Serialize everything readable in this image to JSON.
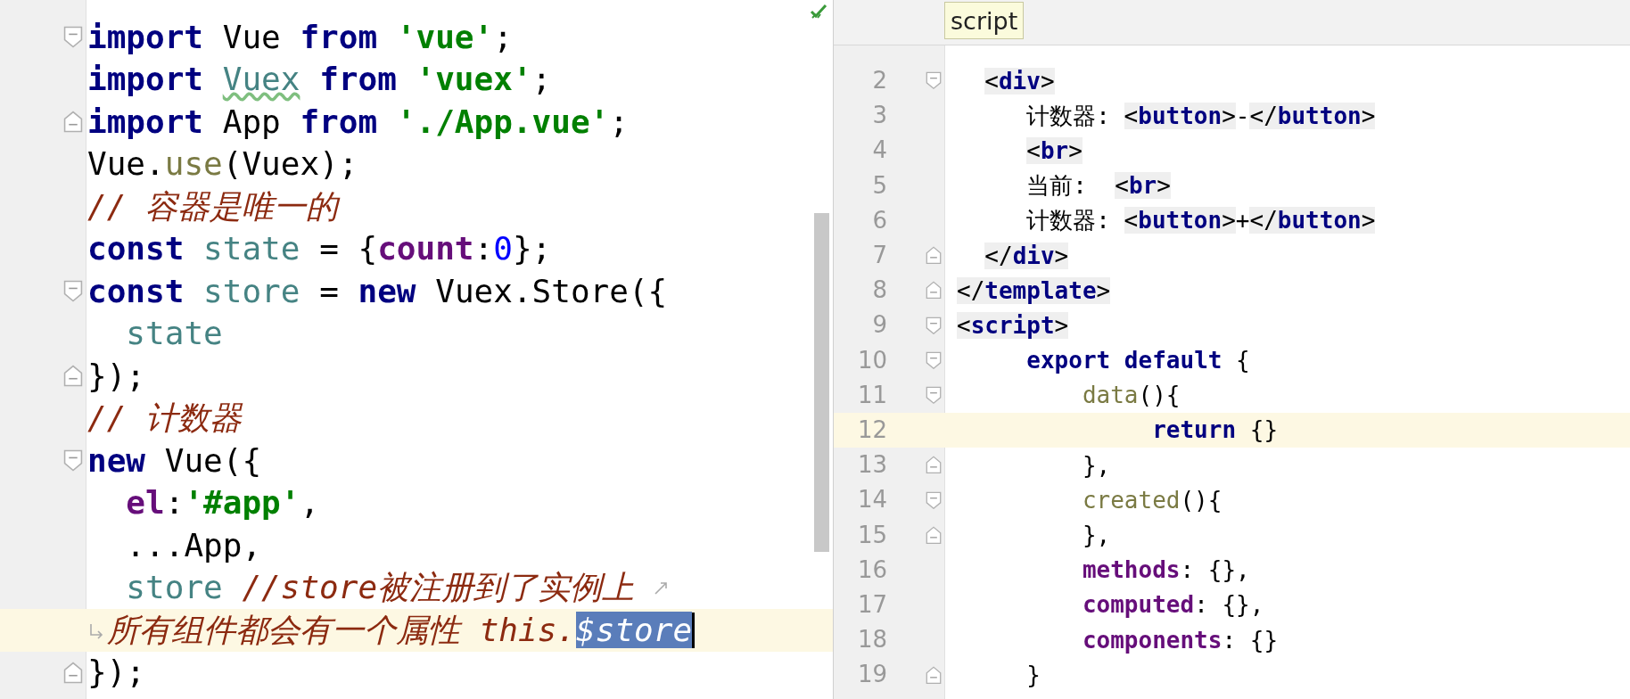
{
  "left_editor": {
    "focused": true,
    "lines": [
      {
        "fold_open": true,
        "fold_close": false,
        "wrap_end": false,
        "wrap_start": false,
        "current": false,
        "tokens": [
          {
            "kind": "keyword",
            "text": "import"
          },
          {
            "kind": "plain",
            "text": " Vue "
          },
          {
            "kind": "keyword",
            "text": "from"
          },
          {
            "kind": "string",
            "text": " 'vue'"
          },
          {
            "kind": "plain",
            "text": ";"
          }
        ]
      },
      {
        "fold_open": false,
        "fold_close": false,
        "wrap_end": false,
        "wrap_start": false,
        "current": false,
        "tokens": [
          {
            "kind": "keyword",
            "text": "import"
          },
          {
            "kind": "field-warning",
            "text": " Vuex"
          },
          {
            "kind": "keyword",
            "text": " from"
          },
          {
            "kind": "string",
            "text": " 'vuex'"
          },
          {
            "kind": "plain",
            "text": ";"
          }
        ]
      },
      {
        "fold_open": false,
        "fold_close": true,
        "wrap_end": false,
        "wrap_start": false,
        "current": false,
        "tokens": [
          {
            "kind": "keyword",
            "text": "import"
          },
          {
            "kind": "plain",
            "text": " App "
          },
          {
            "kind": "keyword",
            "text": "from"
          },
          {
            "kind": "string",
            "text": " './App.vue'"
          },
          {
            "kind": "plain",
            "text": ";"
          }
        ]
      },
      {
        "fold_open": false,
        "fold_close": false,
        "wrap_end": false,
        "wrap_start": false,
        "current": false,
        "tokens": [
          {
            "kind": "plain",
            "text": "Vue."
          },
          {
            "kind": "function",
            "text": "use"
          },
          {
            "kind": "plain",
            "text": "(Vuex);"
          }
        ]
      },
      {
        "fold_open": false,
        "fold_close": false,
        "wrap_end": false,
        "wrap_start": false,
        "current": false,
        "tokens": [
          {
            "kind": "comment",
            "text": "// 容器是唯一的"
          }
        ]
      },
      {
        "fold_open": false,
        "fold_close": false,
        "wrap_end": false,
        "wrap_start": false,
        "current": false,
        "tokens": [
          {
            "kind": "keyword",
            "text": "const"
          },
          {
            "kind": "field",
            "text": " state"
          },
          {
            "kind": "plain",
            "text": " = {"
          },
          {
            "kind": "property",
            "text": "count"
          },
          {
            "kind": "plain",
            "text": ":"
          },
          {
            "kind": "number",
            "text": "0"
          },
          {
            "kind": "plain",
            "text": "};"
          }
        ]
      },
      {
        "fold_open": true,
        "fold_close": false,
        "wrap_end": false,
        "wrap_start": false,
        "current": false,
        "tokens": [
          {
            "kind": "keyword",
            "text": "const"
          },
          {
            "kind": "field",
            "text": " store"
          },
          {
            "kind": "plain",
            "text": " = "
          },
          {
            "kind": "keyword",
            "text": "new"
          },
          {
            "kind": "plain",
            "text": " Vuex.Store({"
          }
        ]
      },
      {
        "fold_open": false,
        "fold_close": false,
        "wrap_end": false,
        "wrap_start": false,
        "current": false,
        "tokens": [
          {
            "kind": "field",
            "text": "  state"
          }
        ]
      },
      {
        "fold_open": false,
        "fold_close": true,
        "wrap_end": false,
        "wrap_start": false,
        "current": false,
        "tokens": [
          {
            "kind": "plain",
            "text": "});"
          }
        ]
      },
      {
        "fold_open": false,
        "fold_close": false,
        "wrap_end": false,
        "wrap_start": false,
        "current": false,
        "tokens": [
          {
            "kind": "comment",
            "text": "// 计数器"
          }
        ]
      },
      {
        "fold_open": true,
        "fold_close": false,
        "wrap_end": false,
        "wrap_start": false,
        "current": false,
        "tokens": [
          {
            "kind": "keyword",
            "text": "new"
          },
          {
            "kind": "plain",
            "text": " Vue({"
          }
        ]
      },
      {
        "fold_open": false,
        "fold_close": false,
        "wrap_end": false,
        "wrap_start": false,
        "current": false,
        "tokens": [
          {
            "kind": "property",
            "text": "  el"
          },
          {
            "kind": "plain",
            "text": ":"
          },
          {
            "kind": "string",
            "text": "'#app'"
          },
          {
            "kind": "plain",
            "text": ","
          }
        ]
      },
      {
        "fold_open": false,
        "fold_close": false,
        "wrap_end": false,
        "wrap_start": false,
        "current": false,
        "tokens": [
          {
            "kind": "plain",
            "text": "  ...App,"
          }
        ]
      },
      {
        "fold_open": false,
        "fold_close": false,
        "wrap_end": true,
        "wrap_start": false,
        "current": false,
        "tokens": [
          {
            "kind": "field",
            "text": "  store"
          },
          {
            "kind": "comment",
            "text": " //store被注册到了实例上"
          }
        ]
      },
      {
        "fold_open": false,
        "fold_close": false,
        "wrap_end": false,
        "wrap_start": true,
        "current": true,
        "tokens": [
          {
            "kind": "comment",
            "text": "所有组件都会有一个属性 this."
          },
          {
            "kind": "selection",
            "text": "$store"
          }
        ]
      },
      {
        "fold_open": false,
        "fold_close": true,
        "wrap_end": false,
        "wrap_start": false,
        "current": false,
        "tokens": [
          {
            "kind": "plain",
            "text": "});"
          }
        ]
      }
    ]
  },
  "right_editor": {
    "focused": false,
    "tooltip": "script",
    "lines": [
      {
        "number": "2",
        "fold_open": true,
        "fold_close": false,
        "current": false,
        "tokens": [
          {
            "kind": "tag-punct",
            "text": "  <"
          },
          {
            "kind": "tag",
            "text": "div"
          },
          {
            "kind": "tag-punct",
            "text": ">"
          }
        ]
      },
      {
        "number": "3",
        "fold_open": false,
        "fold_close": false,
        "current": false,
        "tokens": [
          {
            "kind": "plain",
            "text": "     计数器: "
          },
          {
            "kind": "tag-punct",
            "text": "<"
          },
          {
            "kind": "tag",
            "text": "button"
          },
          {
            "kind": "tag-punct",
            "text": ">"
          },
          {
            "kind": "plain",
            "text": "-"
          },
          {
            "kind": "tag-punct",
            "text": "</"
          },
          {
            "kind": "tag",
            "text": "button"
          },
          {
            "kind": "tag-punct",
            "text": ">"
          }
        ]
      },
      {
        "number": "4",
        "fold_open": false,
        "fold_close": false,
        "current": false,
        "tokens": [
          {
            "kind": "tag-punct",
            "text": "     <"
          },
          {
            "kind": "tag",
            "text": "br"
          },
          {
            "kind": "tag-punct",
            "text": ">"
          }
        ]
      },
      {
        "number": "5",
        "fold_open": false,
        "fold_close": false,
        "current": false,
        "tokens": [
          {
            "kind": "plain",
            "text": "     当前:  "
          },
          {
            "kind": "tag-punct",
            "text": "<"
          },
          {
            "kind": "tag",
            "text": "br"
          },
          {
            "kind": "tag-punct",
            "text": ">"
          }
        ]
      },
      {
        "number": "6",
        "fold_open": false,
        "fold_close": false,
        "current": false,
        "tokens": [
          {
            "kind": "plain",
            "text": "     计数器: "
          },
          {
            "kind": "tag-punct",
            "text": "<"
          },
          {
            "kind": "tag",
            "text": "button"
          },
          {
            "kind": "tag-punct",
            "text": ">"
          },
          {
            "kind": "plain",
            "text": "+"
          },
          {
            "kind": "tag-punct",
            "text": "</"
          },
          {
            "kind": "tag",
            "text": "button"
          },
          {
            "kind": "tag-punct",
            "text": ">"
          }
        ]
      },
      {
        "number": "7",
        "fold_open": false,
        "fold_close": true,
        "current": false,
        "tokens": [
          {
            "kind": "tag-punct",
            "text": "  </"
          },
          {
            "kind": "tag",
            "text": "div"
          },
          {
            "kind": "tag-punct",
            "text": ">"
          }
        ]
      },
      {
        "number": "8",
        "fold_open": false,
        "fold_close": true,
        "current": false,
        "tokens": [
          {
            "kind": "tag-punct",
            "text": "</"
          },
          {
            "kind": "tag",
            "text": "template"
          },
          {
            "kind": "tag-punct",
            "text": ">"
          }
        ]
      },
      {
        "number": "9",
        "fold_open": true,
        "fold_close": false,
        "current": false,
        "tokens": [
          {
            "kind": "tag-punct",
            "text": "<"
          },
          {
            "kind": "tag",
            "text": "script"
          },
          {
            "kind": "tag-punct",
            "text": ">"
          }
        ]
      },
      {
        "number": "10",
        "fold_open": true,
        "fold_close": false,
        "current": false,
        "tokens": [
          {
            "kind": "keyword",
            "text": "     export"
          },
          {
            "kind": "keyword",
            "text": " default"
          },
          {
            "kind": "plain",
            "text": " {"
          }
        ]
      },
      {
        "number": "11",
        "fold_open": true,
        "fold_close": false,
        "current": false,
        "tokens": [
          {
            "kind": "function",
            "text": "         data"
          },
          {
            "kind": "plain",
            "text": "(){"
          }
        ]
      },
      {
        "number": "12",
        "fold_open": false,
        "fold_close": false,
        "current": true,
        "tokens": [
          {
            "kind": "keyword",
            "text": "              return"
          },
          {
            "kind": "plain",
            "text": " {}"
          }
        ]
      },
      {
        "number": "13",
        "fold_open": false,
        "fold_close": true,
        "current": false,
        "tokens": [
          {
            "kind": "plain",
            "text": "         },"
          }
        ]
      },
      {
        "number": "14",
        "fold_open": true,
        "fold_close": false,
        "current": false,
        "tokens": [
          {
            "kind": "function",
            "text": "         created"
          },
          {
            "kind": "plain",
            "text": "(){"
          }
        ]
      },
      {
        "number": "15",
        "fold_open": false,
        "fold_close": true,
        "current": false,
        "tokens": [
          {
            "kind": "plain",
            "text": "         },"
          }
        ]
      },
      {
        "number": "16",
        "fold_open": false,
        "fold_close": false,
        "current": false,
        "tokens": [
          {
            "kind": "property",
            "text": "         methods"
          },
          {
            "kind": "plain",
            "text": ": {},"
          }
        ]
      },
      {
        "number": "17",
        "fold_open": false,
        "fold_close": false,
        "current": false,
        "tokens": [
          {
            "kind": "property",
            "text": "         computed"
          },
          {
            "kind": "plain",
            "text": ": {},"
          }
        ]
      },
      {
        "number": "18",
        "fold_open": false,
        "fold_close": false,
        "current": false,
        "tokens": [
          {
            "kind": "property",
            "text": "         components"
          },
          {
            "kind": "plain",
            "text": ": {}"
          }
        ]
      },
      {
        "number": "19",
        "fold_open": false,
        "fold_close": true,
        "current": false,
        "tokens": [
          {
            "kind": "plain",
            "text": "     }"
          }
        ]
      }
    ]
  }
}
